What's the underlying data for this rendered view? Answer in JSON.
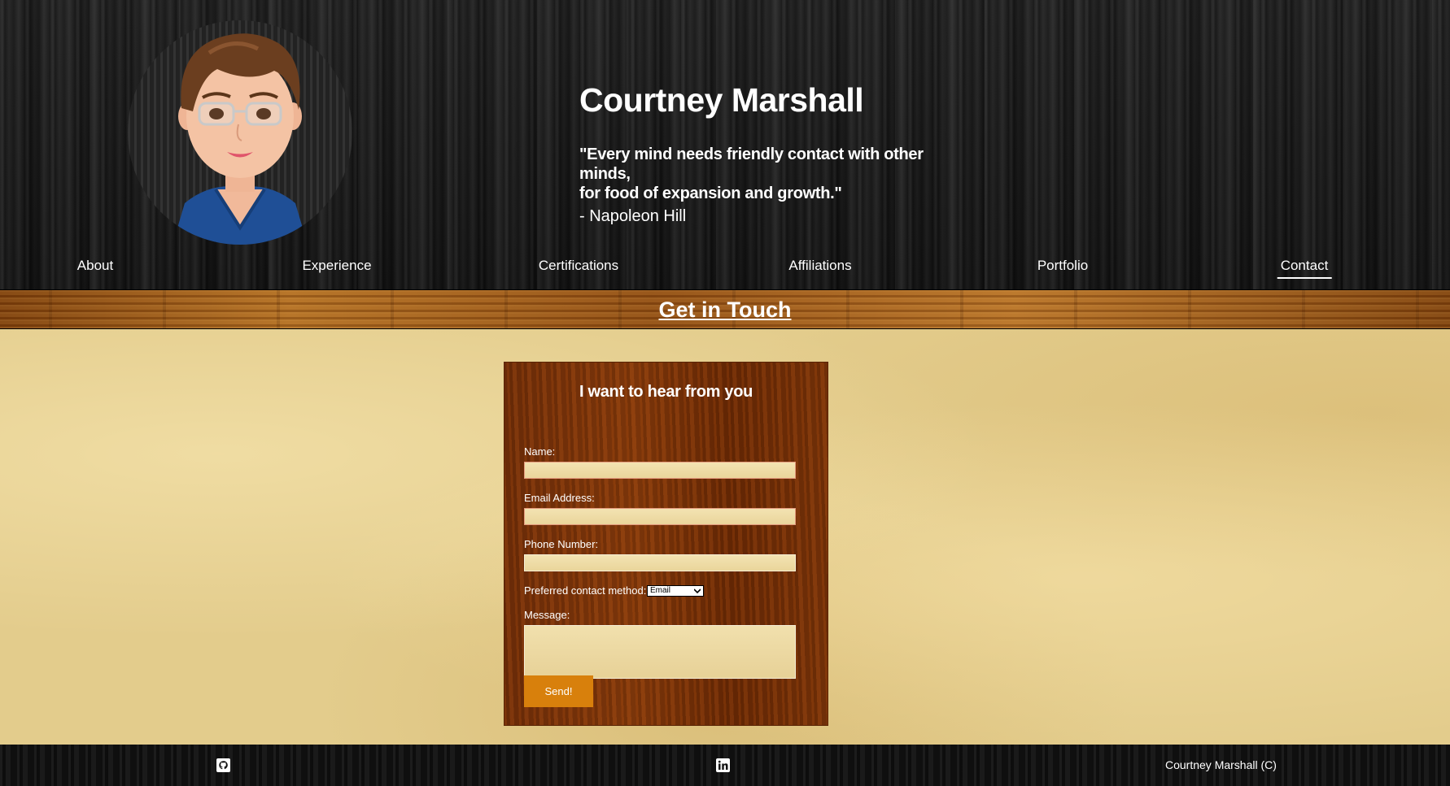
{
  "header": {
    "name": "Courtney Marshall",
    "quote_line1": "\"Every mind needs friendly contact with other minds,",
    "quote_line2": "for food of expansion and growth.\"",
    "quote_author": "- Napoleon Hill",
    "avatar_icon": "cartoon-avatar"
  },
  "nav": {
    "items": [
      {
        "label": "About"
      },
      {
        "label": "Experience"
      },
      {
        "label": "Certifications"
      },
      {
        "label": "Affiliations"
      },
      {
        "label": "Portfolio"
      },
      {
        "label": "Contact",
        "active": true
      }
    ]
  },
  "section": {
    "title": "Get in Touch"
  },
  "form": {
    "title": "I want to hear from you",
    "name_label": "Name:",
    "name_value": "",
    "email_label": "Email Address:",
    "email_value": "",
    "phone_label": "Phone Number:",
    "phone_value": "",
    "contact_method_label": "Preferred contact method:",
    "contact_method_selected": "Email",
    "message_label": "Message:",
    "message_value": "",
    "submit_label": "Send!"
  },
  "footer": {
    "icons": [
      "github-icon",
      "linkedin-icon"
    ],
    "copyright": "Courtney Marshall (C)"
  },
  "colors": {
    "header_bg": "#121212",
    "title_bar_wood": "#8a4f14",
    "parchment": "#e3cc8c",
    "form_wood": "#6e2e06",
    "button": "#d8800c",
    "text_light": "#ffffff"
  }
}
